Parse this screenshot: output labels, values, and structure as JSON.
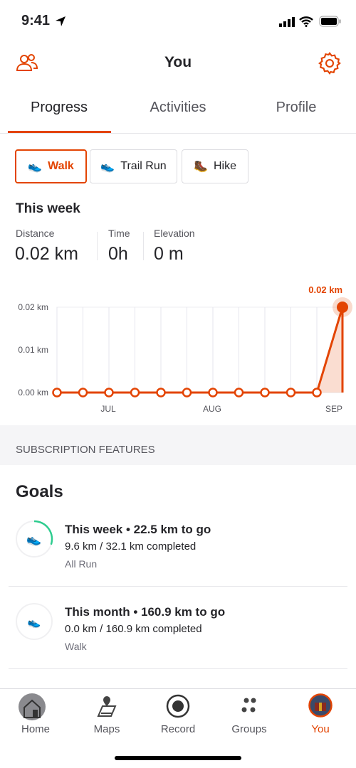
{
  "status_bar": {
    "time": "9:41"
  },
  "header": {
    "title": "You",
    "left_icon": "people-icon",
    "right_icon": "gear-icon"
  },
  "tabs": [
    {
      "label": "Progress",
      "active": true
    },
    {
      "label": "Activities"
    },
    {
      "label": "Profile"
    }
  ],
  "sport_chips": [
    {
      "label": "Walk",
      "active": true
    },
    {
      "label": "Trail Run"
    },
    {
      "label": "Hike"
    }
  ],
  "week": {
    "title": "This week",
    "stats": [
      {
        "label": "Distance",
        "value": "0.02 km"
      },
      {
        "label": "Time",
        "value": "0h"
      },
      {
        "label": "Elevation",
        "value": "0 m"
      }
    ]
  },
  "chart_data": {
    "type": "line",
    "x_labels": [
      "JUL",
      "AUG",
      "SEP"
    ],
    "y_ticks": [
      "0.00 km",
      "0.01 km",
      "0.02 km"
    ],
    "ylim": [
      0,
      0.02
    ],
    "values": [
      0,
      0,
      0,
      0,
      0,
      0,
      0,
      0,
      0,
      0,
      0,
      0.02
    ],
    "highlight_label": "0.02 km",
    "grid": true,
    "color": "#e34402"
  },
  "subscription_label": "SUBSCRIPTION FEATURES",
  "goals": {
    "title": "Goals",
    "items": [
      {
        "title": "This week • 22.5 km to go",
        "progress_text": "9.6 km / 32.1 km completed",
        "type": "All Run",
        "progress": 0.3,
        "icon": "run-shoe-icon"
      },
      {
        "title": "This month • 160.9 km to go",
        "progress_text": "0.0 km / 160.9 km completed",
        "type": "Walk",
        "progress": 0,
        "icon": "walk-shoe-icon"
      }
    ]
  },
  "nav": [
    {
      "label": "Home"
    },
    {
      "label": "Maps"
    },
    {
      "label": "Record"
    },
    {
      "label": "Groups"
    },
    {
      "label": "You",
      "active": true
    }
  ],
  "colors": {
    "accent": "#e34402",
    "goal_ring": "#2ecc8f"
  }
}
